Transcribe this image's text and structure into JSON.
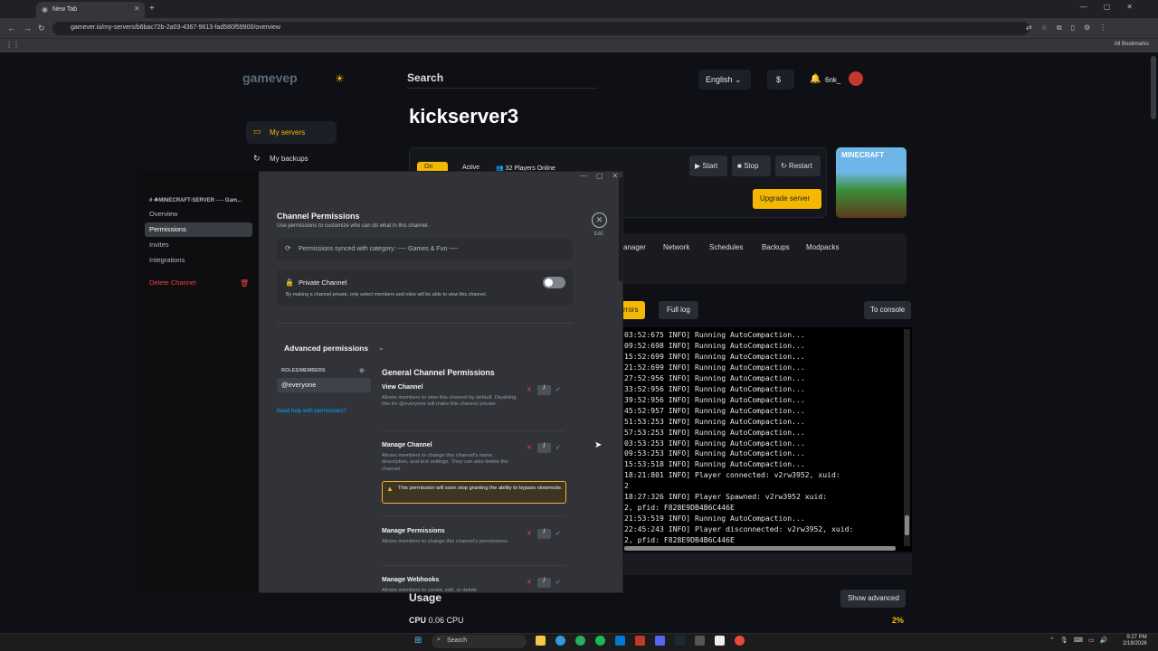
{
  "browser": {
    "tab_title": "New Tab",
    "url": "gamever.io/my-servers/b6bac72b-2a03-4367-9613-fad580f59900/overview",
    "all_bookmarks": "All Bookmarks"
  },
  "site": {
    "logo": "gamevep",
    "search": "Search",
    "language": "English",
    "currency": "$",
    "username": "6nk_",
    "nav": {
      "servers": "My servers",
      "backups": "My backups"
    },
    "server_name": "kickserver3",
    "status": {
      "on": "On",
      "active": "Active",
      "players": "32 Players Online"
    },
    "buttons": {
      "start": "Start",
      "stop": "Stop",
      "restart": "Restart",
      "upgrade": "Upgrade server"
    },
    "image_text": "MINECRAFT",
    "tabs": [
      "anager",
      "Network",
      "Schedules",
      "Backups",
      "Modpacks"
    ],
    "log_tabs": {
      "errors": "rrors",
      "full": "Full log",
      "console": "To console"
    },
    "console_lines": [
      "03:52:675 INFO] Running AutoCompaction...",
      "09:52:698 INFO] Running AutoCompaction...",
      "15:52:699 INFO] Running AutoCompaction...",
      "21:52:699 INFO] Running AutoCompaction...",
      "27:52:956 INFO] Running AutoCompaction...",
      "33:52:956 INFO] Running AutoCompaction...",
      "39:52:956 INFO] Running AutoCompaction...",
      "45:52:957 INFO] Running AutoCompaction...",
      "51:53:253 INFO] Running AutoCompaction...",
      "57:53:253 INFO] Running AutoCompaction...",
      "03:53:253 INFO] Running AutoCompaction...",
      "09:53:253 INFO] Running AutoCompaction...",
      "15:53:518 INFO] Running AutoCompaction...",
      "18:21:801 INFO] Player connected: v2rw3952, xuid:",
      "2",
      "18:27:326 INFO] Player Spawned: v2rw3952 xuid:",
      "2, pfid: F828E9DB4B6C446E",
      "21:53:519 INFO] Running AutoCompaction...",
      "22:45:243 INFO] Player disconnected: v2rw3952, xuid:",
      "2, pfid: F828E9DB4B6C446E"
    ],
    "usage": "Usage",
    "cpu_label": "CPU",
    "cpu_value": "0.06 CPU",
    "cpu_pct": "2%",
    "show_advanced": "Show advanced"
  },
  "discord": {
    "channel": "# ☘MINECRAFT-SERVER ── Gam...",
    "side": {
      "overview": "Overview",
      "permissions": "Permissions",
      "invites": "Invites",
      "integrations": "Integrations",
      "delete": "Delete Channel"
    },
    "title": "Channel Permissions",
    "subtitle": "Use permissions to customize who can do what in this channel.",
    "esc": "ESC",
    "sync": "Permissions synced with category: ── Games & Fun ──",
    "private_label": "Private Channel",
    "private_desc": "By making a channel private, only select members and roles will be able to view this channel.",
    "advanced": "Advanced permissions",
    "roles_label": "ROLES/MEMBERS",
    "everyone": "@everyone",
    "help": "Need help with permissions?",
    "general_title": "General Channel Permissions",
    "perms": [
      {
        "name": "View Channel",
        "desc": "Allows members to view this channel by default. Disabling this for @everyone will make this channel private."
      },
      {
        "name": "Manage Channel",
        "desc": "Allows members to change this channel's name, description, and text settings. They can also delete the channel."
      },
      {
        "name": "Manage Permissions",
        "desc": "Allows members to change this channel's permissions."
      },
      {
        "name": "Manage Webhooks",
        "desc": "Allows members to create, edit, or delete"
      }
    ],
    "warning": "This permission will soon stop granting the ability to bypass slowmode."
  },
  "taskbar": {
    "search": "Search",
    "time": "9:27 PM",
    "date": "2/18/2026"
  },
  "colors": {
    "accent": "#f5b800",
    "discord_bg": "#313338",
    "danger": "#f23f43",
    "link": "#00a8fc"
  }
}
